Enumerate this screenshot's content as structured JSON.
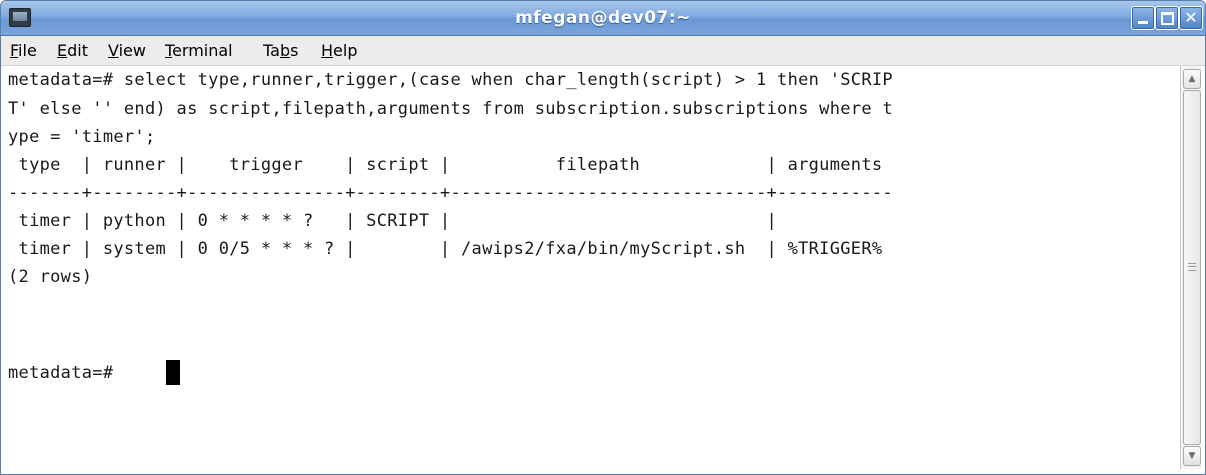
{
  "window": {
    "title": "mfegan@dev07:~"
  },
  "menu": [
    {
      "pre": "",
      "u": "F",
      "post": "ile"
    },
    {
      "pre": "",
      "u": "E",
      "post": "dit"
    },
    {
      "pre": "",
      "u": "V",
      "post": "iew"
    },
    {
      "pre": "",
      "u": "T",
      "post": "erminal"
    },
    {
      "pre": "Ta",
      "u": "b",
      "post": "s"
    },
    {
      "pre": "",
      "u": "H",
      "post": "elp"
    }
  ],
  "terminal": {
    "lines": [
      "metadata=# select type,runner,trigger,(case when char_length(script) > 1 then 'SCRIP",
      "T' else '' end) as script,filepath,arguments from subscription.subscriptions where t",
      "ype = 'timer';",
      " type  | runner |    trigger    | script |          filepath            | arguments",
      "-------+--------+---------------+--------+------------------------------+-----------",
      " timer | python | 0 * * * * ?   | SCRIPT |                              |",
      " timer | system | 0 0/5 * * * ? |        | /awips2/fxa/bin/myScript.sh  | %TRIGGER%",
      "(2 rows)",
      "",
      "metadata=# "
    ]
  },
  "icons": {
    "app": "terminal-icon",
    "minimize": "minimize-icon",
    "maximize": "maximize-icon",
    "close": "close-icon",
    "close_glyph": "✕",
    "scroll_up": "▲",
    "scroll_down": "▼"
  },
  "colors": {
    "titlebar": "#80aae0",
    "menubar": "#edeceb",
    "terminal_bg": "#ffffff",
    "terminal_fg": "#1a1a1a"
  }
}
